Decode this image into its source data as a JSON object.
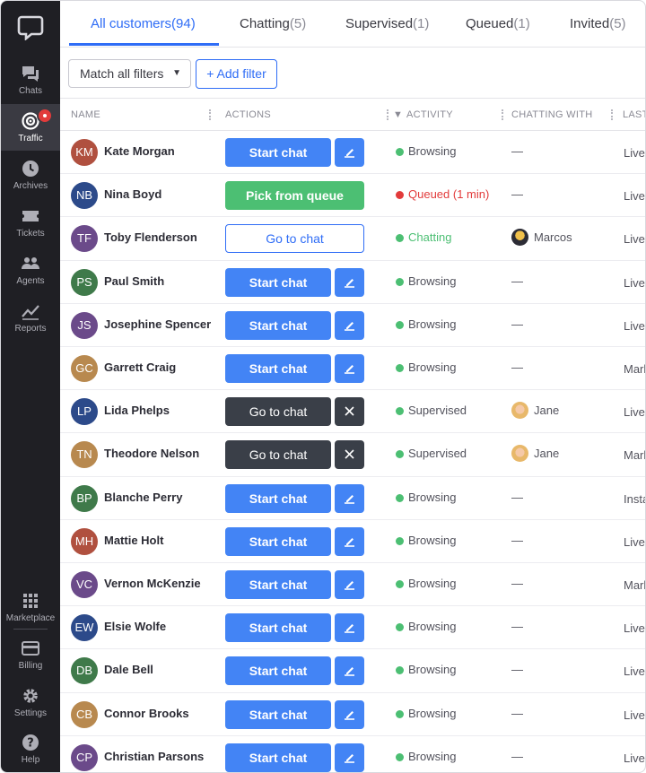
{
  "sidebar": {
    "items": [
      {
        "label": "Chats",
        "icon": "chats-icon"
      },
      {
        "label": "Traffic",
        "icon": "traffic-icon",
        "active": true
      },
      {
        "label": "Archives",
        "icon": "archives-icon"
      },
      {
        "label": "Tickets",
        "icon": "tickets-icon"
      },
      {
        "label": "Agents",
        "icon": "agents-icon"
      },
      {
        "label": "Reports",
        "icon": "reports-icon"
      }
    ],
    "bottom_items": [
      {
        "label": "Marketplace",
        "icon": "marketplace-icon"
      },
      {
        "label": "Billing",
        "icon": "billing-icon"
      },
      {
        "label": "Settings",
        "icon": "settings-icon"
      },
      {
        "label": "Help",
        "icon": "help-icon"
      }
    ]
  },
  "tabs": [
    {
      "label": "All customers",
      "count": "(94)"
    },
    {
      "label": "Chatting",
      "count": "(5)"
    },
    {
      "label": "Supervised",
      "count": "(1)"
    },
    {
      "label": "Queued",
      "count": "(1)"
    },
    {
      "label": "Invited",
      "count": "(5)"
    }
  ],
  "filters": {
    "match_label": "Match all filters",
    "add_filter_label": "+ Add filter"
  },
  "columns": [
    "NAME",
    "ACTIONS",
    "ACTIVITY",
    "CHATTING WITH",
    "LAST"
  ],
  "colors": {
    "accent": "#2f6df6",
    "green": "#4cbf73",
    "red": "#e23b3b",
    "dark": "#3a3f48"
  },
  "customers": [
    {
      "initials": "KM",
      "name": "Kate Morgan",
      "avatar_color": "#b0503f",
      "action": "Start chat",
      "activity": "Browsing",
      "chatting_with": "—",
      "last": "LiveC"
    },
    {
      "initials": "NB",
      "name": "Nina Boyd",
      "avatar_color": "#2c4a8a",
      "action": "Pick from queue",
      "activity": "Queued (1 min)",
      "chatting_with": "—",
      "last": "LiveC"
    },
    {
      "initials": "TF",
      "name": "Toby Flenderson",
      "avatar_color": "#6b4a8a",
      "action": "Go to chat",
      "activity": "Chatting",
      "chatting_with": "Marcos",
      "last": "LiveC"
    },
    {
      "initials": "PS",
      "name": "Paul Smith",
      "avatar_color": "#3f7a4a",
      "action": "Start chat",
      "activity": "Browsing",
      "chatting_with": "—",
      "last": "Live"
    },
    {
      "initials": "JS",
      "name": "Josephine Spencer",
      "avatar_color": "#6b4a8a",
      "action": "Start chat",
      "activity": "Browsing",
      "chatting_with": "—",
      "last": "LiveC"
    },
    {
      "initials": "GC",
      "name": "Garrett Craig",
      "avatar_color": "#b8894f",
      "action": "Start chat",
      "activity": "Browsing",
      "chatting_with": "—",
      "last": "Mark"
    },
    {
      "initials": "LP",
      "name": "Lida Phelps",
      "avatar_color": "#2c4a8a",
      "action": "Go to chat",
      "activity": "Supervised",
      "chatting_with": "Jane",
      "last": "LiveC"
    },
    {
      "initials": "TN",
      "name": "Theodore Nelson",
      "avatar_color": "#b8894f",
      "action": "Go to chat",
      "activity": "Supervised",
      "chatting_with": "Jane",
      "last": "Mark"
    },
    {
      "initials": "BP",
      "name": "Blanche Perry",
      "avatar_color": "#3f7a4a",
      "action": "Start chat",
      "activity": "Browsing",
      "chatting_with": "—",
      "last": "Insta"
    },
    {
      "initials": "MH",
      "name": "Mattie Holt",
      "avatar_color": "#b0503f",
      "action": "Start chat",
      "activity": "Browsing",
      "chatting_with": "—",
      "last": "LiveC"
    },
    {
      "initials": "VC",
      "name": "Vernon McKenzie",
      "avatar_color": "#6b4a8a",
      "action": "Start chat",
      "activity": "Browsing",
      "chatting_with": "—",
      "last": "Mark"
    },
    {
      "initials": "EW",
      "name": "Elsie Wolfe",
      "avatar_color": "#2c4a8a",
      "action": "Start chat",
      "activity": "Browsing",
      "chatting_with": "—",
      "last": "LiveC"
    },
    {
      "initials": "DB",
      "name": "Dale Bell",
      "avatar_color": "#3f7a4a",
      "action": "Start chat",
      "activity": "Browsing",
      "chatting_with": "—",
      "last": "LiveC"
    },
    {
      "initials": "CB",
      "name": "Connor Brooks",
      "avatar_color": "#b8894f",
      "action": "Start chat",
      "activity": "Browsing",
      "chatting_with": "—",
      "last": "LiveC"
    },
    {
      "initials": "CP",
      "name": "Christian Parsons",
      "avatar_color": "#6b4a8a",
      "action": "Start chat",
      "activity": "Browsing",
      "chatting_with": "—",
      "last": "LiveC"
    }
  ]
}
